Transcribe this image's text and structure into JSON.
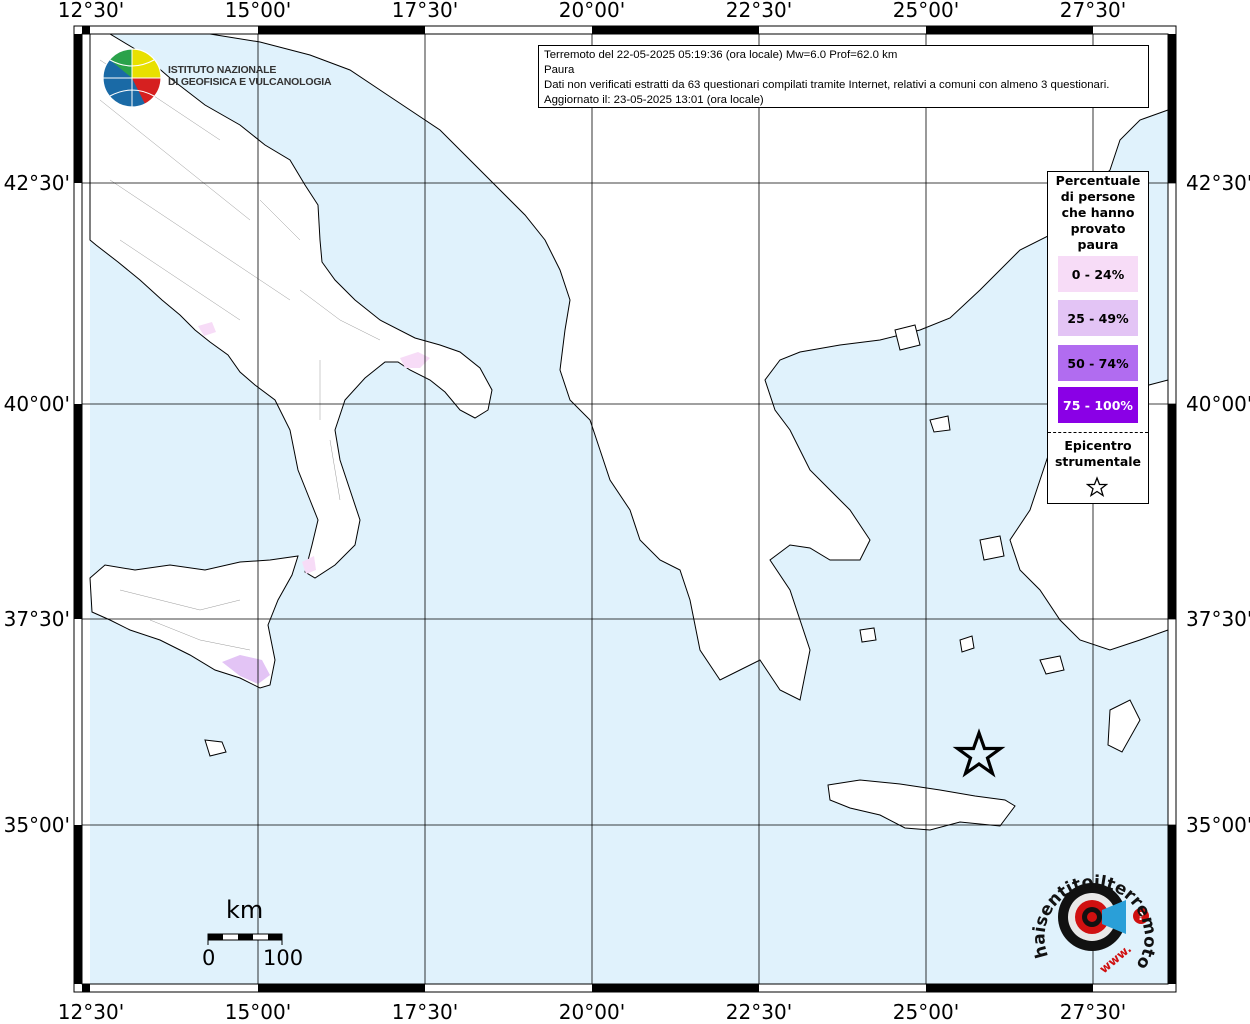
{
  "info": {
    "line1": "Terremoto del 22-05-2025 05:19:36 (ora locale) Mw=6.0 Prof=62.0 km",
    "line2": "Paura",
    "line3": "Dati non verificati estratti da 63 questionari compilati tramite Internet, relativi a comuni con almeno 3 questionari.",
    "line4": "Aggiornato il: 23-05-2025 13:01 (ora locale)"
  },
  "logo": {
    "line1": "ISTITUTO NAZIONALE",
    "line2": "DI GEOFISICA E VULCANOLOGIA",
    "icon": "ingv-globe-icon"
  },
  "legend": {
    "title_lines": [
      "Percentuale",
      "di persone",
      "che hanno",
      "provato",
      "paura"
    ],
    "classes": [
      {
        "label": "0 - 24%",
        "color": "#f7dcf7",
        "text_color": "#000000"
      },
      {
        "label": "25 - 49%",
        "color": "#e3c4f5",
        "text_color": "#000000"
      },
      {
        "label": "50 - 74%",
        "color": "#b16cf0",
        "text_color": "#000000"
      },
      {
        "label": "75 - 100%",
        "color": "#8a00e6",
        "text_color": "#ffffff"
      }
    ],
    "epicenter_lines": [
      "Epicentro",
      "strumentale"
    ],
    "epicenter_icon": "star-outline-icon"
  },
  "axes": {
    "lon_labels": [
      "12°30'",
      "15°00'",
      "17°30'",
      "20°00'",
      "22°30'",
      "25°00'",
      "27°30'"
    ],
    "lat_labels": [
      "42°30'",
      "40°00'",
      "37°30'",
      "35°00'"
    ]
  },
  "scale_bar": {
    "title": "km",
    "min": "0",
    "max": "100"
  },
  "badge": {
    "text": "haisentitoilterremoto.it",
    "prefix": "www.",
    "icon": "haisentito-logo-icon"
  },
  "colors": {
    "sea": "#e0f2fc",
    "land": "#ffffff",
    "coast": "#000000"
  }
}
